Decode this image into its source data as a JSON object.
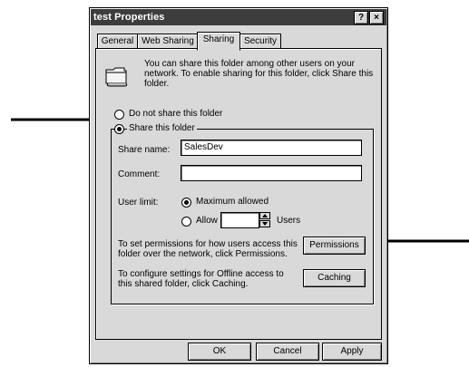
{
  "window": {
    "title": "test Properties",
    "help_button": "?",
    "close_button": "×"
  },
  "tabs": [
    {
      "label": "General",
      "active": false
    },
    {
      "label": "Web Sharing",
      "active": false
    },
    {
      "label": "Sharing",
      "active": true
    },
    {
      "label": "Security",
      "active": false
    }
  ],
  "sharing": {
    "description": "You can share this folder among other users on your network.  To enable sharing for this folder, click Share this folder.",
    "folder_icon": "shared-folder-icon",
    "options": {
      "do_not_share_label": "Do not share this folder",
      "share_label": "Share this folder",
      "selected": "share"
    },
    "share_name_label": "Share name:",
    "share_name_value": "SalesDev",
    "comment_label": "Comment:",
    "comment_value": "",
    "user_limit_label": "User limit:",
    "max_allowed_label": "Maximum allowed",
    "allow_label": "Allow",
    "allow_value": "",
    "users_label": "Users",
    "user_limit_selected": "maximum",
    "permissions_text": "To set permissions for how users access this folder over the network, click Permissions.",
    "permissions_button": "Permissions",
    "caching_text": "To configure settings for Offline access to this shared folder, click Caching.",
    "caching_button": "Caching"
  },
  "footer": {
    "ok_label": "OK",
    "cancel_label": "Cancel",
    "apply_label": "Apply"
  },
  "annotations": [
    {
      "name": "arrow-right-icon",
      "points_to": "Share this folder"
    },
    {
      "name": "arrow-left-icon",
      "points_to": "Permissions"
    }
  ]
}
